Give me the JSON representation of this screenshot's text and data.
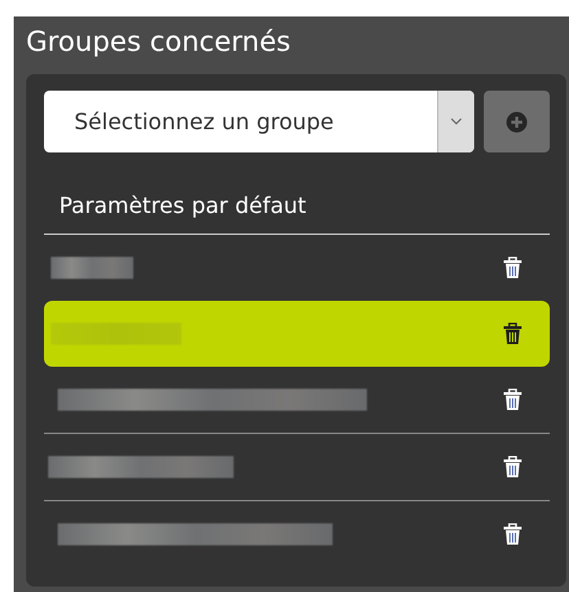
{
  "panel": {
    "title": "Groupes concernés"
  },
  "select": {
    "placeholder": "Sélectionnez un groupe"
  },
  "default_label": "Paramètres par défaut",
  "groups": [
    {
      "selected": false,
      "separated": false
    },
    {
      "selected": true,
      "separated": false
    },
    {
      "selected": false,
      "separated": false
    },
    {
      "selected": false,
      "separated": true
    },
    {
      "selected": false,
      "separated": true
    }
  ]
}
